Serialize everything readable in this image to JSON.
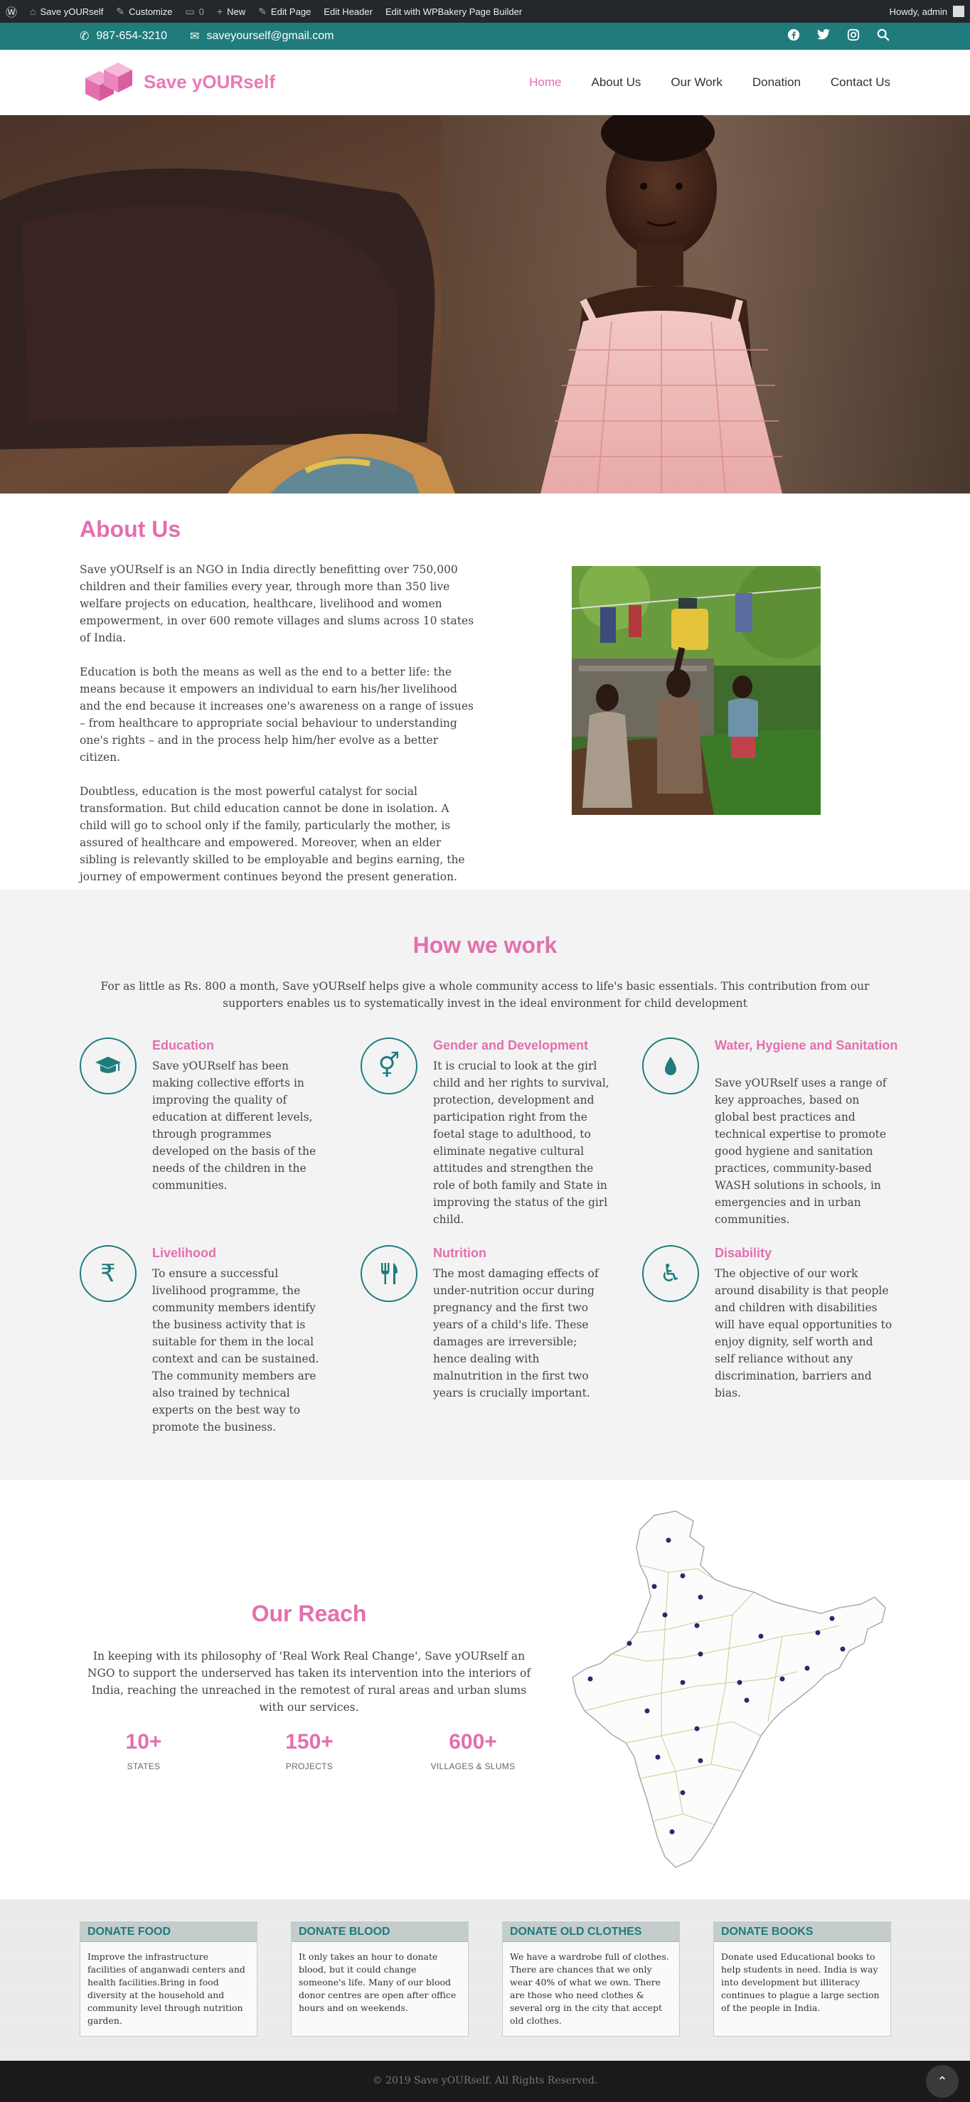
{
  "adminbar": {
    "site_name": "Save yOURself",
    "customize": "Customize",
    "comments_count": "0",
    "new": "New",
    "edit_page": "Edit Page",
    "edit_header": "Edit Header",
    "edit_wpbakery": "Edit with WPBakery Page Builder",
    "howdy": "Howdy, admin"
  },
  "topstrip": {
    "phone": "987-654-3210",
    "email": "saveyourself@gmail.com",
    "social_icons": [
      "facebook-icon",
      "twitter-icon",
      "instagram-icon",
      "search-icon"
    ],
    "color": "#1f7b7c"
  },
  "header": {
    "logo_text": "Save yOURself",
    "nav": [
      "Home",
      "About Us",
      "Our Work",
      "Donation",
      "Contact Us"
    ],
    "active_nav": "Home",
    "accent": "#e36fae"
  },
  "about": {
    "title": "About Us",
    "paragraphs": [
      "Save yOURself is an NGO in India directly benefitting over 750,000 children and their families every year, through more than 350 live welfare projects on education, healthcare, livelihood and women empowerment, in over 600 remote villages and slums across 10 states of India.",
      "Education is both the means as well as the end to a better life: the means because it empowers an individual to earn his/her livelihood and the end because it increases one's awareness on a range of issues – from healthcare to appropriate social behaviour to understanding one's rights – and in the process help him/her evolve as a better citizen.",
      "Doubtless, education is the most powerful catalyst for social transformation. But child education cannot be done in isolation. A child will go to school only if the family, particularly the mother, is assured of healthcare and empowered. Moreover, when an elder sibling is relevantly skilled to be employable and begins earning, the journey of empowerment continues beyond the present generation."
    ]
  },
  "how": {
    "title": "How we work",
    "intro": "For as little as Rs. 800 a month, Save yOURself helps give a whole community access to life's basic essentials. This contribution from our supporters enables us to systematically invest in the ideal environment for child development",
    "features": [
      {
        "title": "Education",
        "icon": "graduation-cap-icon",
        "glyph": "🎓",
        "text": "Save yOURself has been making collective efforts in improving the quality of education at different levels, through programmes developed on the basis of the needs of the children in the communities."
      },
      {
        "title": "Gender and Development",
        "icon": "gender-icon",
        "glyph": "⚥",
        "text": "It is crucial to look at the girl child and her rights to survival, protection, development and participation right from the foetal stage to adulthood, to eliminate negative cultural attitudes and strengthen the role of both family and State in improving the status of the girl child."
      },
      {
        "title": "Water, Hygiene and Sanitation",
        "icon": "water-drop-icon",
        "glyph": "💧",
        "text": "Save yOURself uses a range of key approaches, based on global best practices and technical expertise to promote good hygiene and sanitation practices, community-based WASH solutions in schools, in emergencies and in urban communities."
      },
      {
        "title": "Livelihood",
        "icon": "rupee-icon",
        "glyph": "₹",
        "text": "To ensure a successful livelihood programme, the community members identify the business activity that is suitable for them in the local context and can be sustained. The community members are also trained by technical experts on the best way to promote the business."
      },
      {
        "title": "Nutrition",
        "icon": "cutlery-icon",
        "glyph": "🍴",
        "text": "The most damaging effects of under-nutrition occur during pregnancy and the first two years of a child's life. These damages are irreversible; hence dealing with malnutrition in the first two years is crucially important."
      },
      {
        "title": "Disability",
        "icon": "wheelchair-icon",
        "glyph": "♿",
        "text": "The objective of our work around disability is that people and children with disabilities will have equal opportunities to enjoy dignity, self worth and self reliance without any discrimination, barriers and bias."
      }
    ]
  },
  "reach": {
    "title": "Our Reach",
    "text": "In keeping with its philosophy of 'Real Work Real Change', Save yOURself an NGO to support the underserved has taken its intervention into the interiors of India, reaching the unreached in the remotest of rural areas and urban slums with our services.",
    "stats": [
      {
        "num": "10+",
        "label": "STATES"
      },
      {
        "num": "150+",
        "label": "PROJECTS"
      },
      {
        "num": "600+",
        "label": "VILLAGES & SLUMS"
      }
    ]
  },
  "donate": [
    {
      "title": "DONATE FOOD",
      "text": "Improve the infrastructure facilities of anganwadi centers and health facilities.Bring in food diversity at the household and community level through nutrition garden."
    },
    {
      "title": "DONATE BLOOD",
      "text": "It only takes an hour to donate blood, but it could change someone's life. Many of our blood donor centres are open after office hours and on weekends."
    },
    {
      "title": "DONATE OLD CLOTHES",
      "text": "We have a wardrobe full of clothes. There are chances that we only wear 40% of what we own. There are those who need clothes & several org in the city that accept old clothes."
    },
    {
      "title": "DONATE BOOKS",
      "text": "Donate used Educational books to help students in need. India is way into development but illiteracy continues to plague a large section of the people in India."
    }
  ],
  "footer": {
    "copyright": "© 2019 Save yOURself. All Rights Reserved."
  }
}
